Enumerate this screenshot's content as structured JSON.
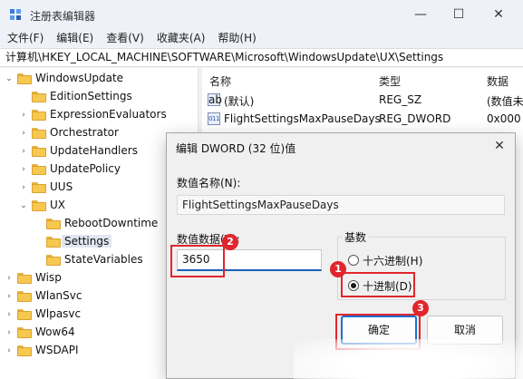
{
  "window": {
    "title": "注册表编辑器",
    "min_glyph": "—",
    "max_glyph": "☐",
    "close_glyph": "✕"
  },
  "menu": [
    "文件(F)",
    "编辑(E)",
    "查看(V)",
    "收藏夹(A)",
    "帮助(H)"
  ],
  "address": "计算机\\HKEY_LOCAL_MACHINE\\SOFTWARE\\Microsoft\\WindowsUpdate\\UX\\Settings",
  "tree": {
    "items": [
      {
        "label": "WindowsUpdate",
        "toggle": "⌄"
      },
      {
        "label": "EditionSettings",
        "toggle": ""
      },
      {
        "label": "ExpressionEvaluators",
        "toggle": "›"
      },
      {
        "label": "Orchestrator",
        "toggle": "›"
      },
      {
        "label": "UpdateHandlers",
        "toggle": "›"
      },
      {
        "label": "UpdatePolicy",
        "toggle": "›"
      },
      {
        "label": "UUS",
        "toggle": "›"
      },
      {
        "label": "UX",
        "toggle": "⌄"
      },
      {
        "label": "RebootDowntime",
        "toggle": ""
      },
      {
        "label": "Settings",
        "toggle": ""
      },
      {
        "label": "StateVariables",
        "toggle": ""
      },
      {
        "label": "Wisp",
        "toggle": "›"
      },
      {
        "label": "WlanSvc",
        "toggle": "›"
      },
      {
        "label": "Wlpasvc",
        "toggle": "›"
      },
      {
        "label": "Wow64",
        "toggle": "›"
      },
      {
        "label": "WSDAPI",
        "toggle": "›"
      }
    ]
  },
  "list": {
    "headers": [
      "名称",
      "类型",
      "数据"
    ],
    "rows": [
      {
        "name": "(默认)",
        "type": "REG_SZ",
        "data": "(数值未",
        "icon": "ab"
      },
      {
        "name": "FlightSettingsMaxPauseDays",
        "type": "REG_DWORD",
        "data": "0x000",
        "icon": "011"
      }
    ]
  },
  "dialog": {
    "title": "编辑 DWORD (32 位)值",
    "close_glyph": "✕",
    "value_name_label": "数值名称(N):",
    "value_name": "FlightSettingsMaxPauseDays",
    "value_data_label": "数值数据(V):",
    "value_data": "3650",
    "base_label": "基数",
    "radio_hex": "十六进制(H)",
    "radio_dec": "十进制(D)",
    "selected_base": "decimal",
    "ok_label": "确定",
    "cancel_label": "取消"
  },
  "annotations": {
    "badge_1": "1",
    "badge_2": "2",
    "badge_3": "3",
    "color": "#e0262c"
  }
}
